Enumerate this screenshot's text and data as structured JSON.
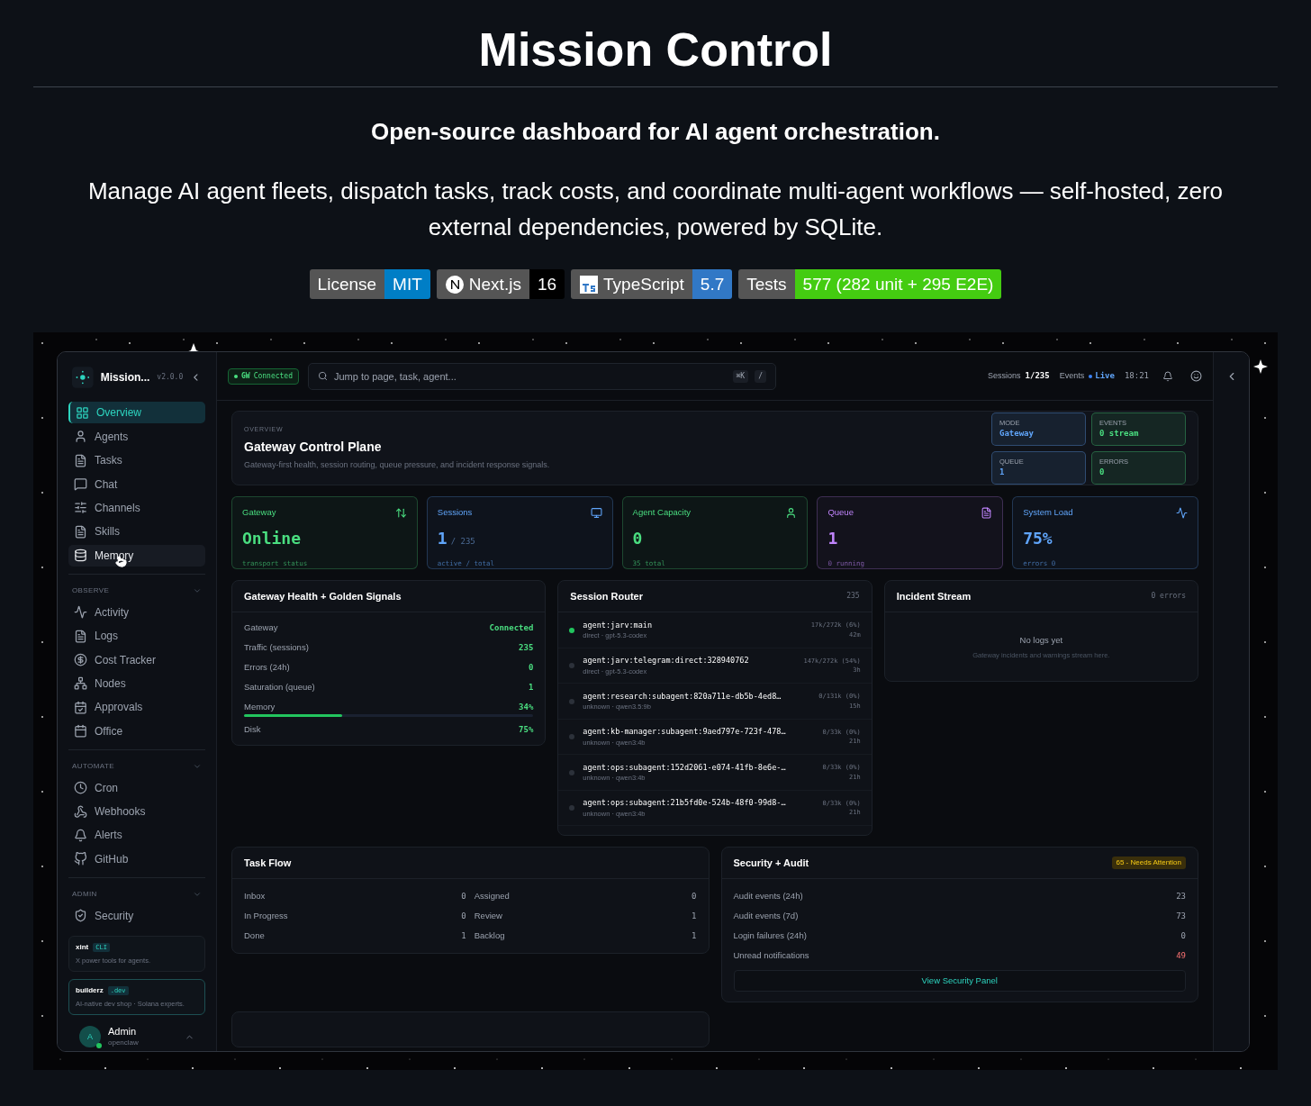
{
  "readme": {
    "title": "Mission Control",
    "tagline": "Open-source dashboard for AI agent orchestration.",
    "description": "Manage AI agent fleets, dispatch tasks, track costs, and coordinate multi-agent workflows — self-hosted, zero external dependencies, powered by SQLite.",
    "badges": [
      {
        "label": "License",
        "value": "MIT",
        "color": "#007ec6",
        "kind": "plain"
      },
      {
        "label": "Next.js",
        "value": "16",
        "color": "#000000",
        "kind": "nextjs"
      },
      {
        "label": "TypeScript",
        "value": "5.7",
        "color": "#3178c6",
        "kind": "typescript"
      },
      {
        "label": "Tests",
        "value": "577 (282 unit + 295 E2E)",
        "color": "#44cc11",
        "kind": "plain"
      }
    ]
  },
  "app": {
    "sidebar": {
      "brand": "Mission...",
      "version": "v2.0.0",
      "sections": [
        {
          "items": [
            {
              "label": "Overview",
              "selected": true,
              "hovered": false
            },
            {
              "label": "Agents",
              "selected": false,
              "hovered": false
            },
            {
              "label": "Tasks",
              "selected": false,
              "hovered": false
            },
            {
              "label": "Chat",
              "selected": false,
              "hovered": false
            },
            {
              "label": "Channels",
              "selected": false,
              "hovered": false
            },
            {
              "label": "Skills",
              "selected": false,
              "hovered": false
            },
            {
              "label": "Memory",
              "selected": false,
              "hovered": true
            }
          ]
        },
        {
          "title": "OBSERVE",
          "expanded": true,
          "items": [
            {
              "label": "Activity",
              "selected": false,
              "hovered": false
            },
            {
              "label": "Logs",
              "selected": false,
              "hovered": false
            },
            {
              "label": "Cost Tracker",
              "selected": false,
              "hovered": false
            },
            {
              "label": "Nodes",
              "selected": false,
              "hovered": false
            },
            {
              "label": "Approvals",
              "selected": false,
              "hovered": false
            },
            {
              "label": "Office",
              "selected": false,
              "hovered": false
            }
          ]
        },
        {
          "title": "AUTOMATE",
          "expanded": true,
          "items": [
            {
              "label": "Cron",
              "selected": false,
              "hovered": false
            },
            {
              "label": "Webhooks",
              "selected": false,
              "hovered": false
            },
            {
              "label": "Alerts",
              "selected": false,
              "hovered": false
            },
            {
              "label": "GitHub",
              "selected": false,
              "hovered": false
            }
          ]
        },
        {
          "title": "ADMIN",
          "expanded": true,
          "items": [
            {
              "label": "Security",
              "selected": false,
              "hovered": false
            }
          ]
        }
      ],
      "promos": [
        {
          "name": "xint",
          "tag": "CLI",
          "text": "X power tools for agents.",
          "highlighted": false
        },
        {
          "name": "builderz",
          "tag": ".dev",
          "text": "AI-native dev shop · Solana experts.",
          "highlighted": true
        }
      ],
      "user": {
        "initial": "A",
        "name": "Admin",
        "handle": "openclaw",
        "online": true
      }
    },
    "topbar": {
      "gateway_label": "GW",
      "gateway_status": "Connected",
      "connected": true,
      "search": {
        "placeholder": "Jump to page, task, agent...",
        "shortcuts": [
          "⌘K",
          "/"
        ]
      },
      "sessions_label": "Sessions",
      "sessions": "1/235",
      "events_label": "Events",
      "events_status": "Live",
      "live": true,
      "time": "18:21"
    },
    "overview": {
      "eyebrow": "OVERVIEW",
      "title": "Gateway Control Plane",
      "subtitle": "Gateway-first health, session routing, queue pressure, and incident response signals.",
      "chips": [
        {
          "label": "MODE",
          "value": "Gateway",
          "color": "#60a5fa"
        },
        {
          "label": "EVENTS",
          "value": "0 stream",
          "color": "#4ade80"
        },
        {
          "label": "QUEUE",
          "value": "1",
          "color": "#60a5fa"
        },
        {
          "label": "ERRORS",
          "value": "0",
          "color": "#4ade80"
        }
      ]
    },
    "stats": [
      {
        "title": "Gateway",
        "value": "Online",
        "caption": "transport status",
        "color": "#4ade80"
      },
      {
        "title": "Sessions",
        "value": "1",
        "suffix": "/ 235",
        "caption": "active / total",
        "color": "#60a5fa"
      },
      {
        "title": "Agent Capacity",
        "value": "0",
        "caption": "35 total",
        "color": "#4ade80"
      },
      {
        "title": "Queue",
        "value": "1",
        "caption": "0 running",
        "color": "#c084fc"
      },
      {
        "title": "System Load",
        "value": "75%",
        "caption": "errors 0",
        "color": "#60a5fa"
      }
    ],
    "health": {
      "title": "Gateway Health + Golden Signals",
      "rows": [
        {
          "label": "Gateway",
          "value": "Connected"
        },
        {
          "label": "Traffic (sessions)",
          "value": "235"
        },
        {
          "label": "Errors (24h)",
          "value": "0"
        },
        {
          "label": "Saturation (queue)",
          "value": "1"
        },
        {
          "label": "Memory",
          "value": "34%",
          "level": 0.34
        },
        {
          "label": "Disk",
          "value": "75%"
        }
      ]
    },
    "router": {
      "title": "Session Router",
      "count": "235",
      "sessions": [
        {
          "key": "agent:jarv:main",
          "meta": "direct · gpt-5.3-codex",
          "tokens": "17k/272k (6%)",
          "age": "42m",
          "active": true
        },
        {
          "key": "agent:jarv:telegram:direct:328940762",
          "meta": "direct · gpt-5.3-codex",
          "tokens": "147k/272k (54%)",
          "age": "3h",
          "active": false
        },
        {
          "key": "agent:research:subagent:820a711e-db5b-4ed8…",
          "meta": "unknown · qwen3.5:9b",
          "tokens": "0/131k (0%)",
          "age": "15h",
          "active": false
        },
        {
          "key": "agent:kb-manager:subagent:9aed797e-723f-478…",
          "meta": "unknown · qwen3:4b",
          "tokens": "0/33k (0%)",
          "age": "21h",
          "active": false
        },
        {
          "key": "agent:ops:subagent:152d2061-e074-41fb-8e6e-…",
          "meta": "unknown · qwen3:4b",
          "tokens": "0/33k (0%)",
          "age": "21h",
          "active": false
        },
        {
          "key": "agent:ops:subagent:21b5fd0e-524b-48f0-99d8-…",
          "meta": "unknown · qwen3:4b",
          "tokens": "0/33k (0%)",
          "age": "21h",
          "active": false
        }
      ]
    },
    "incidents": {
      "title": "Incident Stream",
      "count": "0 errors",
      "empty_title": "No logs yet",
      "empty_text": "Gateway incidents and warnings stream here."
    },
    "task_flow": {
      "title": "Task Flow",
      "cells": [
        {
          "label": "Inbox",
          "value": "0"
        },
        {
          "label": "Assigned",
          "value": "0"
        },
        {
          "label": "In Progress",
          "value": "0"
        },
        {
          "label": "Review",
          "value": "1"
        },
        {
          "label": "Done",
          "value": "1"
        },
        {
          "label": "Backlog",
          "value": "1"
        }
      ]
    },
    "security": {
      "title": "Security + Audit",
      "badge": "65 - Needs Attention",
      "rows": [
        {
          "label": "Audit events (24h)",
          "value": "23",
          "alert": false
        },
        {
          "label": "Audit events (7d)",
          "value": "73",
          "alert": false
        },
        {
          "label": "Login failures (24h)",
          "value": "0",
          "alert": false
        },
        {
          "label": "Unread notifications",
          "value": "49",
          "alert": true
        }
      ],
      "button": "View Security Panel"
    }
  }
}
